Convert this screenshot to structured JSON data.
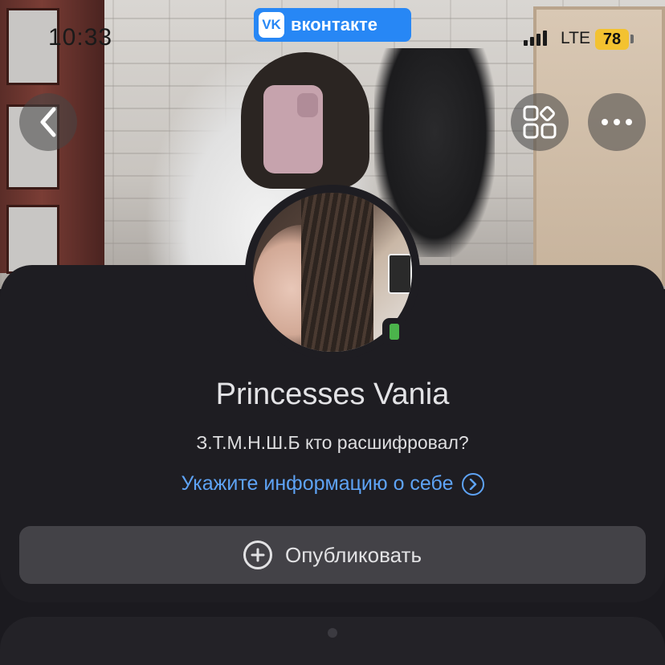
{
  "status_bar": {
    "time": "10:33",
    "network": "LTE",
    "battery": "78"
  },
  "app_badge": {
    "label": "вконтакте",
    "logo": "VK"
  },
  "cover": {
    "buttons": {
      "back_icon": "chevron-left-icon",
      "apps_icon": "apps-grid-icon",
      "more_icon": "more-horizontal-icon"
    }
  },
  "profile": {
    "name": "Princesses Vania",
    "status": "З.Т.М.Н.Ш.Б кто расшифровал?",
    "info_link": "Укажите информацию о себе",
    "online_device": "mobile"
  },
  "actions": {
    "publish_label": "Опубликовать"
  },
  "colors": {
    "accent": "#2787f5",
    "link": "#5ea3f5",
    "online": "#4bb34b",
    "card_bg": "#1e1d22",
    "button_bg": "#434247",
    "battery": "#f3c230"
  }
}
